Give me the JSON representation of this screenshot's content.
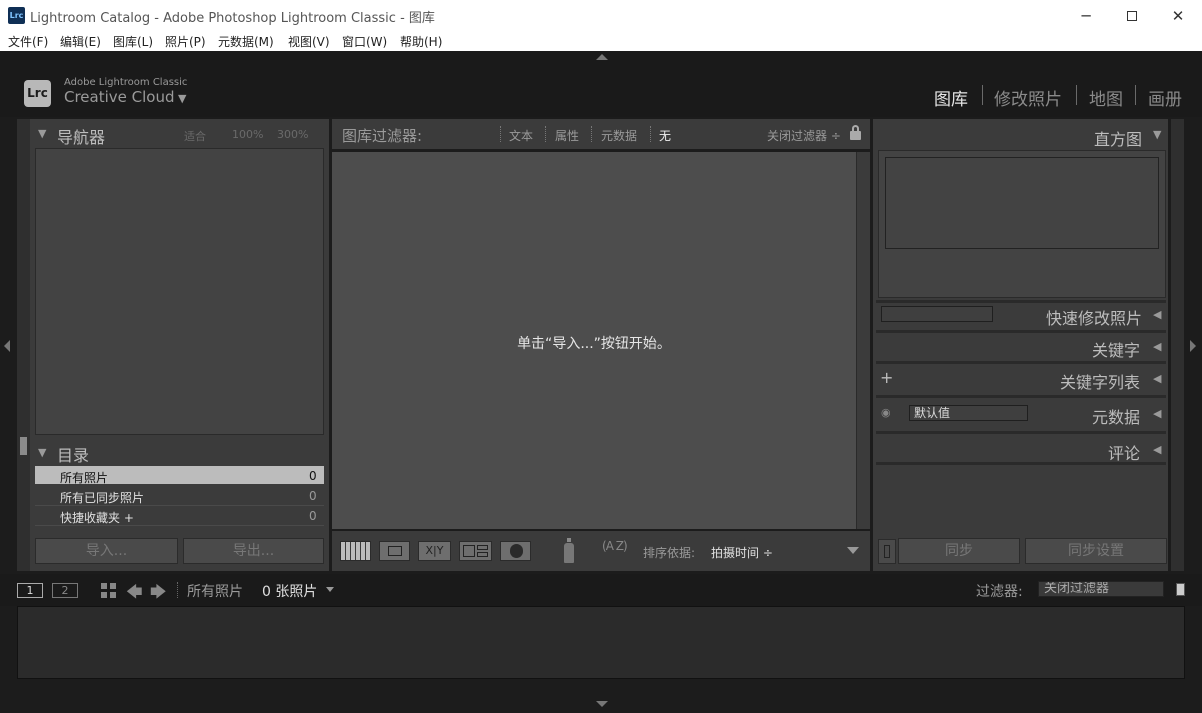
{
  "window": {
    "title": "Lightroom Catalog - Adobe Photoshop Lightroom Classic - 图库",
    "app_icon": "Lrc"
  },
  "menu": [
    "文件(F)",
    "编辑(E)",
    "图库(L)",
    "照片(P)",
    "元数据(M)",
    "视图(V)",
    "窗口(W)",
    "帮助(H)"
  ],
  "brand": {
    "logo": "Lrc",
    "small": "Adobe Lightroom Classic",
    "big": "Creative Cloud"
  },
  "modules": [
    "图库",
    "修改照片",
    "地图",
    "画册"
  ],
  "navigator": {
    "title": "导航器",
    "fit": "适合",
    "zoom1": "100%",
    "zoom2": "300%"
  },
  "catalog": {
    "title": "目录",
    "items": [
      {
        "label": "所有照片",
        "count": "0"
      },
      {
        "label": "所有已同步照片",
        "count": "0"
      },
      {
        "label": "快捷收藏夹 +",
        "count": "0"
      }
    ]
  },
  "left_buttons": {
    "import": "导入...",
    "export": "导出..."
  },
  "filter_bar": {
    "title": "图库过滤器:",
    "options": [
      "文本",
      "属性",
      "元数据",
      "无"
    ],
    "close": "关闭过滤器 ÷"
  },
  "grid": {
    "message": "单击“导入...”按钮开始。"
  },
  "toolbar": {
    "sort_label": "排序依据:",
    "sort_value": "拍摄时间 ÷",
    "sort_icon_text": "A Z"
  },
  "right": {
    "histogram": "直方图",
    "quick_develop": "快速修改照片",
    "keywording": "关键字",
    "keyword_list": "关键字列表",
    "metadata": "元数据",
    "metadata_preset": "默认值",
    "comments": "评论",
    "plus": "+",
    "sync": "同步",
    "sync_settings": "同步设置"
  },
  "filmstrip": {
    "page1": "1",
    "page2": "2",
    "source": "所有照片",
    "count": "0 张照片",
    "filter_label": "过滤器:",
    "filter_value": "关闭过滤器"
  },
  "colors": {
    "panel": "#3b3b3b",
    "grid": "#4d4d4d",
    "background": "#1c1c1c",
    "selected_row": "#bcbcbc"
  }
}
